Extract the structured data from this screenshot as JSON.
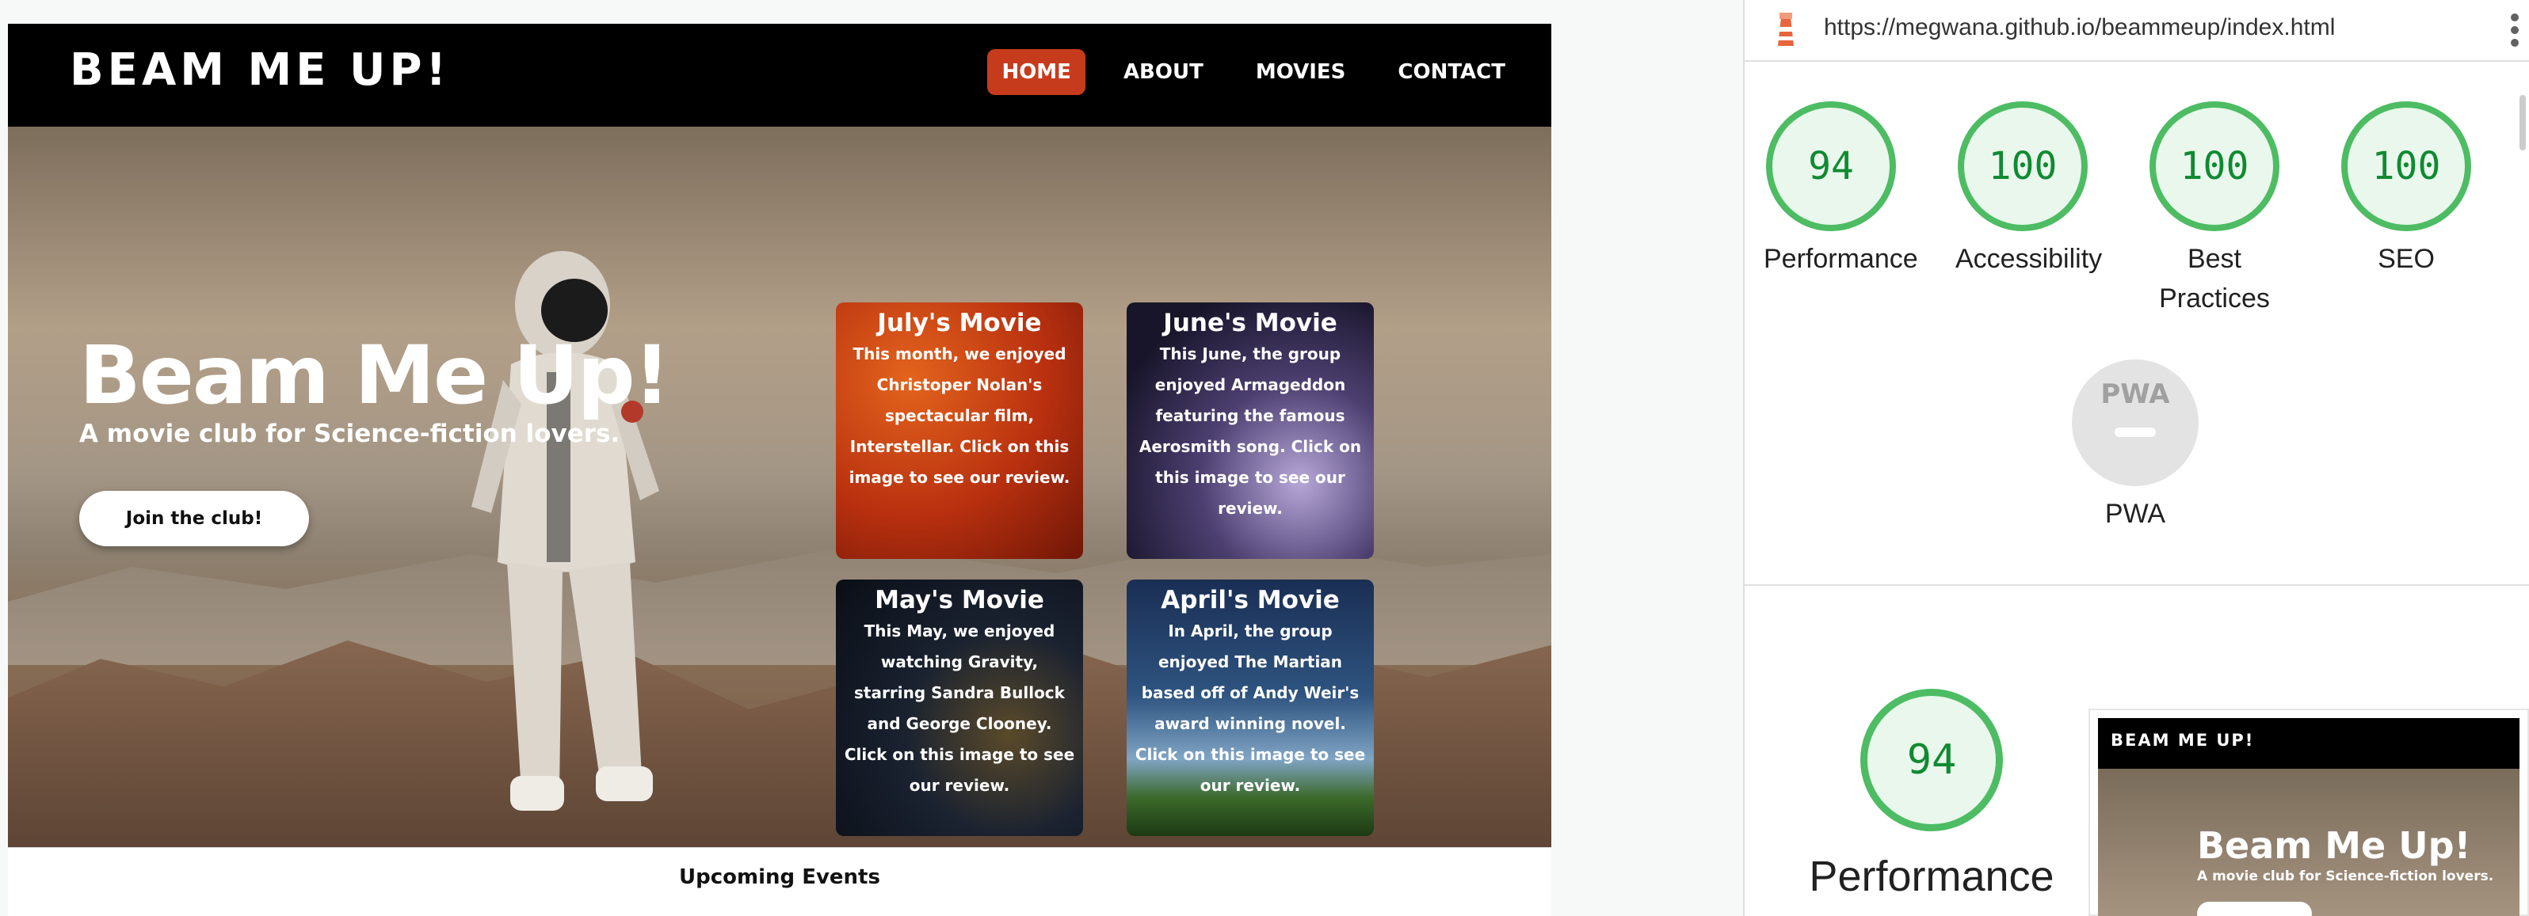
{
  "site": {
    "brand": "BEAM ME UP!",
    "nav": [
      "HOME",
      "ABOUT",
      "MOVIES",
      "CONTACT"
    ],
    "hero": {
      "title": "Beam Me Up!",
      "subtitle": "A movie club for Science-fiction lovers.",
      "button": "Join the club!"
    },
    "cards": [
      {
        "title": "July's Movie",
        "text": "This month, we enjoyed Christoper Nolan's spectacular film, Interstellar. Click on this image to see our review."
      },
      {
        "title": "June's Movie",
        "text": "This June, the group enjoyed Armageddon featuring the famous Aerosmith song. Click on this image to see our review."
      },
      {
        "title": "May's Movie",
        "text": "This May, we enjoyed watching Gravity, starring Sandra Bullock and George Clooney. Click on this image to see our review."
      },
      {
        "title": "April's Movie",
        "text": "In April, the group enjoyed The Martian based off of Andy Weir's award winning novel. Click on this image to see our review."
      }
    ],
    "events_title": "Upcoming Events"
  },
  "lighthouse": {
    "url": "https://megwana.github.io/beammeup/index.html",
    "scores": [
      {
        "value": "94",
        "label": "Performance"
      },
      {
        "value": "100",
        "label": "Accessibility"
      },
      {
        "value": "100",
        "label": "Best Practices"
      },
      {
        "value": "100",
        "label": "SEO"
      }
    ],
    "pwa": {
      "badge": "PWA",
      "label": "PWA"
    },
    "detail": {
      "value": "94",
      "label": "Performance"
    },
    "thumbnail": {
      "brand": "BEAM ME UP!",
      "title": "Beam Me Up!",
      "subtitle": "A movie club for Science-fiction lovers."
    },
    "colors": {
      "pass": "#4dbc63",
      "pass_text": "#108a32"
    }
  }
}
